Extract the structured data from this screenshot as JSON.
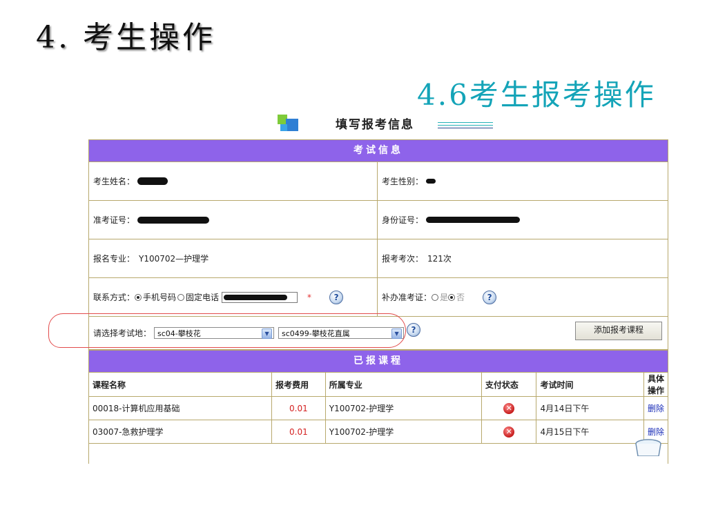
{
  "slide": {
    "title": "4.  考生操作",
    "subtitle": "4.6考生报考操作"
  },
  "form": {
    "heading": "填写报考信息",
    "exam_info_bar": "考试信息",
    "name_label": "考生姓名：",
    "gender_label": "考生性别：",
    "ticket_label": "准考证号：",
    "id_label": "身份证号：",
    "major_label": "报名专业：",
    "major_value": "Y100702—护理学",
    "count_label": "报考考次：",
    "count_value": "121次",
    "contact_label": "联系方式：",
    "contact_mobile": "手机号码",
    "contact_landline": "固定电话",
    "required_star": "*",
    "reissue_label": "补办准考证：",
    "reissue_yes": "是",
    "reissue_no": "否",
    "location_label": "请选择考试地：",
    "location_select_1": "sc04-攀枝花",
    "location_select_2": "sc0499-攀枝花直属",
    "add_button": "添加报考课程",
    "help_glyph": "?"
  },
  "courses": {
    "bar": "已报课程",
    "headers": [
      "课程名称",
      "报考费用",
      "所属专业",
      "支付状态",
      "考试时间",
      "具体操作"
    ],
    "rows": [
      {
        "name": "00018-计算机应用基础",
        "fee": "0.01",
        "major": "Y100702-护理学",
        "status": "unpaid",
        "time": "4月14日下午",
        "action": "删除"
      },
      {
        "name": "03007-急救护理学",
        "fee": "0.01",
        "major": "Y100702-护理学",
        "status": "unpaid",
        "time": "4月15日下午",
        "action": "删除"
      }
    ],
    "status_glyph": "✕"
  },
  "colors": {
    "bar_purple": "#8e63ea",
    "subtitle_teal": "#14a4b8",
    "fee_red": "#d42020",
    "link_blue": "#1c2fb8",
    "highlight_red": "#e24a4a"
  },
  "icons": [
    "form-logo-icon",
    "help-icon",
    "unpaid-status-icon",
    "trash-icon"
  ]
}
